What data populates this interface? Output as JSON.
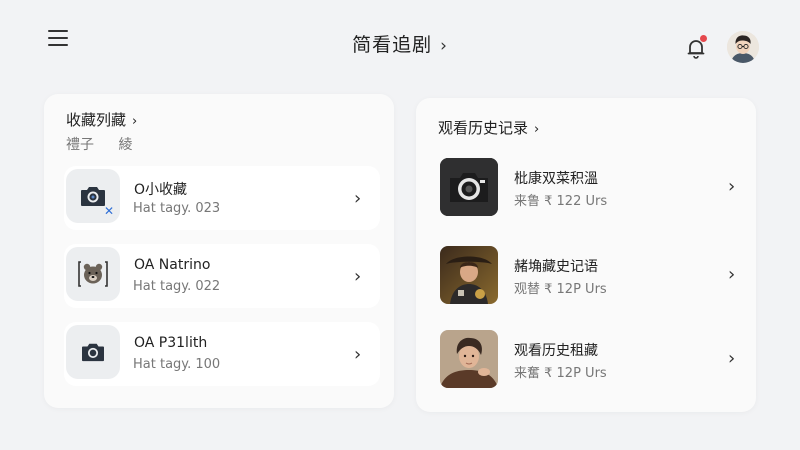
{
  "header": {
    "title": "简看追剧",
    "title_chevron_icon": "chevron-right-icon",
    "menu_icon": "hamburger-menu-icon",
    "notification_icon": "bell-icon",
    "notification_dot_color": "#e5484d",
    "avatar_icon": "user-avatar"
  },
  "favorites": {
    "title": "收藏列藏",
    "subtabs": [
      "禮子",
      "綾"
    ],
    "items": [
      {
        "title": "O小收藏",
        "subtitle": "Hat tagy. 023",
        "icon": "camera-icon",
        "badge_icon": "close-icon"
      },
      {
        "title": "OA Natrino",
        "subtitle": "Hat tagy. 022",
        "icon": "bear-icon"
      },
      {
        "title": "OA P31lith",
        "subtitle": "Hat tagy. 100",
        "icon": "camera-icon"
      }
    ]
  },
  "history": {
    "title": "观看历史记录",
    "items": [
      {
        "title": "枇康双菜积溫",
        "subtitle": "来鲁 ₹ 122 Urs",
        "thumb": "camera-thumb"
      },
      {
        "title": "赭埆藏史记语",
        "subtitle": "观替 ₹ 12P Urs",
        "thumb": "warrior-portrait-thumb"
      },
      {
        "title": "观看历史租藏",
        "subtitle": "来奮 ₹ 12P Urs",
        "thumb": "man-portrait-thumb"
      }
    ]
  },
  "colors": {
    "background": "#f2f3f5",
    "card": "#fafafa",
    "accent_blue": "#2f6fd6",
    "text_primary": "#222222",
    "text_secondary": "#777777"
  }
}
